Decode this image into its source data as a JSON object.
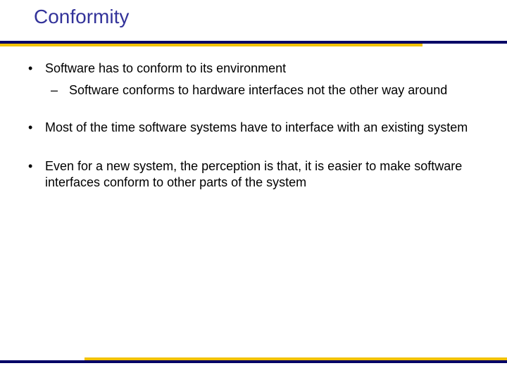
{
  "title": "Conformity",
  "bullets": {
    "b1_0": "Software has to conform to its environment",
    "b2_0": "Software conforms to hardware interfaces not the other way around",
    "b1_1": "Most of the time software systems have to interface with an existing system",
    "b1_2": "Even for a new system, the perception is that, it is easier to make software interfaces conform to other parts of the system"
  },
  "glyphs": {
    "dot": "•",
    "dash": "–"
  }
}
